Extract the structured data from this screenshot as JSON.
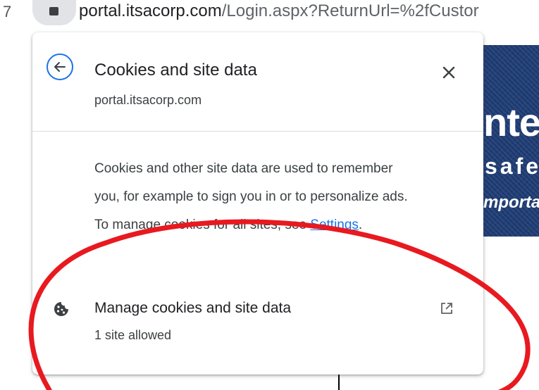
{
  "browser": {
    "left_glyph": "7",
    "url_host": "portal.itsacorp.com",
    "url_path": "/Login.aspx?ReturnUrl=%2fCustor"
  },
  "background_page": {
    "banner_line1": "nte",
    "banner_line2": "safe",
    "banner_line3": "mporta",
    "banner_color": "#1e3c74"
  },
  "popup": {
    "back_icon": "arrow-back-icon",
    "title": "Cookies and site data",
    "subtitle": "portal.itsacorp.com",
    "close_icon": "close-icon",
    "description_text": "Cookies and other site data are used to remember you, for example to sign you in or to personalize ads. To manage cookies for all sites, see ",
    "settings_link": "Settings",
    "description_end": ".",
    "manage": {
      "icon": "cookie-icon",
      "title": "Manage cookies and site data",
      "subtitle": "1 site allowed",
      "external_icon": "open-in-new-icon"
    }
  },
  "colors": {
    "accent": "#1a73e8",
    "annotation": "#e8191f"
  }
}
